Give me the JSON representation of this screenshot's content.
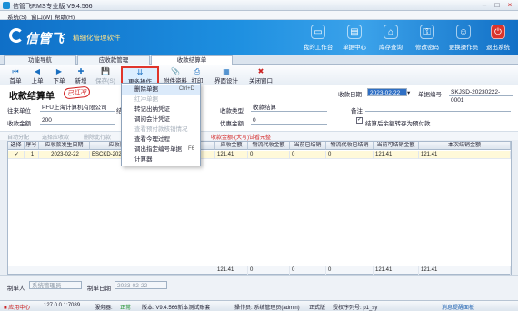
{
  "window": {
    "title": "信管飞RMS专业版 V9.4.566"
  },
  "menu": [
    "系统(S)",
    "窗口(W)",
    "帮助(H)"
  ],
  "banner": {
    "brand": "信管飞",
    "slogan": "精细化管理软件",
    "buttons": [
      {
        "label": "我的工作台",
        "icon": "desktop-icon"
      },
      {
        "label": "单据中心",
        "icon": "documents-icon"
      },
      {
        "label": "库存查询",
        "icon": "warehouse-icon"
      },
      {
        "label": "修改密码",
        "icon": "key-icon"
      },
      {
        "label": "更换操作员",
        "icon": "user-switch-icon"
      },
      {
        "label": "退出系统",
        "icon": "power-icon"
      }
    ]
  },
  "tabs": [
    "功能导航",
    "应收款管理",
    "收款结算单"
  ],
  "toolbar": {
    "first": "首单",
    "prev": "上单",
    "next": "下单",
    "new": "新增",
    "save": "保存(S)",
    "audit": "审核(A)",
    "more": "更多操作",
    "attach": "附件资料",
    "print": "打印",
    "ui": "界面设计",
    "close": "关闭窗口"
  },
  "dropdown": [
    {
      "label": "删除单据",
      "shortcut": "Ctrl+D",
      "enabled": true
    },
    {
      "label": "红冲单据",
      "shortcut": "",
      "enabled": false
    },
    {
      "label": "转记出纳凭证",
      "shortcut": "",
      "enabled": true
    },
    {
      "label": "调阅会计凭证",
      "shortcut": "",
      "enabled": true
    },
    {
      "label": "查看预付款核销情况",
      "shortcut": "",
      "enabled": false
    },
    {
      "label": "查看今理过程",
      "shortcut": "",
      "enabled": true
    },
    {
      "label": "调出指定编号单据",
      "shortcut": "F6",
      "enabled": true
    },
    {
      "label": "计算器",
      "shortcut": "",
      "enabled": true
    }
  ],
  "form": {
    "title": "收款结算单",
    "stamp": "已红冲",
    "date_label": "收款日期",
    "date_value": "2023-02-22",
    "no_label": "单据编号",
    "no_value": "SKJSD-20230222-0001",
    "customer_label": "往来单位",
    "customer_value": "PFU上海计算机有限公司",
    "amount_label": "收款金额",
    "amount_value": "200",
    "type_label": "收款类型",
    "type_value": "收款结算",
    "discount_label": "优惠金额",
    "discount_value": "0",
    "remark_label": "备注",
    "checkbox_label": "结算后余额转存为预付款",
    "field2_label": "结"
  },
  "subbar": {
    "auto": "自动分配",
    "select": "选择应收款",
    "clear": "删除此行款",
    "hint": "收款金额-(大写)试看元整"
  },
  "grid": {
    "headers": [
      "选择",
      "序号",
      "应收款发生日期",
      "应收款单",
      "人",
      "应收金额",
      "物流代收金额",
      "当前已结销",
      "物流代收已结销",
      "当前可结销金额",
      "本次结销金额"
    ],
    "rows": [
      [
        "✓",
        "1",
        "2023-02-22",
        "ESCKD-202302",
        "",
        "121.41",
        "0",
        "0",
        "0",
        "121.41",
        "121.41"
      ]
    ],
    "totals": [
      "121.41",
      "0",
      "0",
      "0",
      "121.41",
      "121.41"
    ]
  },
  "footer": {
    "maker_label": "制单人",
    "maker_value": "系统管理员",
    "date_label": "制单日期",
    "date_value": "2023-02-22"
  },
  "status": {
    "app": "应用中心",
    "ip": "127.0.0.1:7089",
    "conn_label": "服务器:",
    "conn": "正常",
    "ver": "版本: V9.4.566新本测试账套",
    "op": "操作员: 系统管理员(admin)",
    "edition": "正式版",
    "auth": "授权序列号: p1_sy",
    "msg": "消息提醒面板"
  }
}
